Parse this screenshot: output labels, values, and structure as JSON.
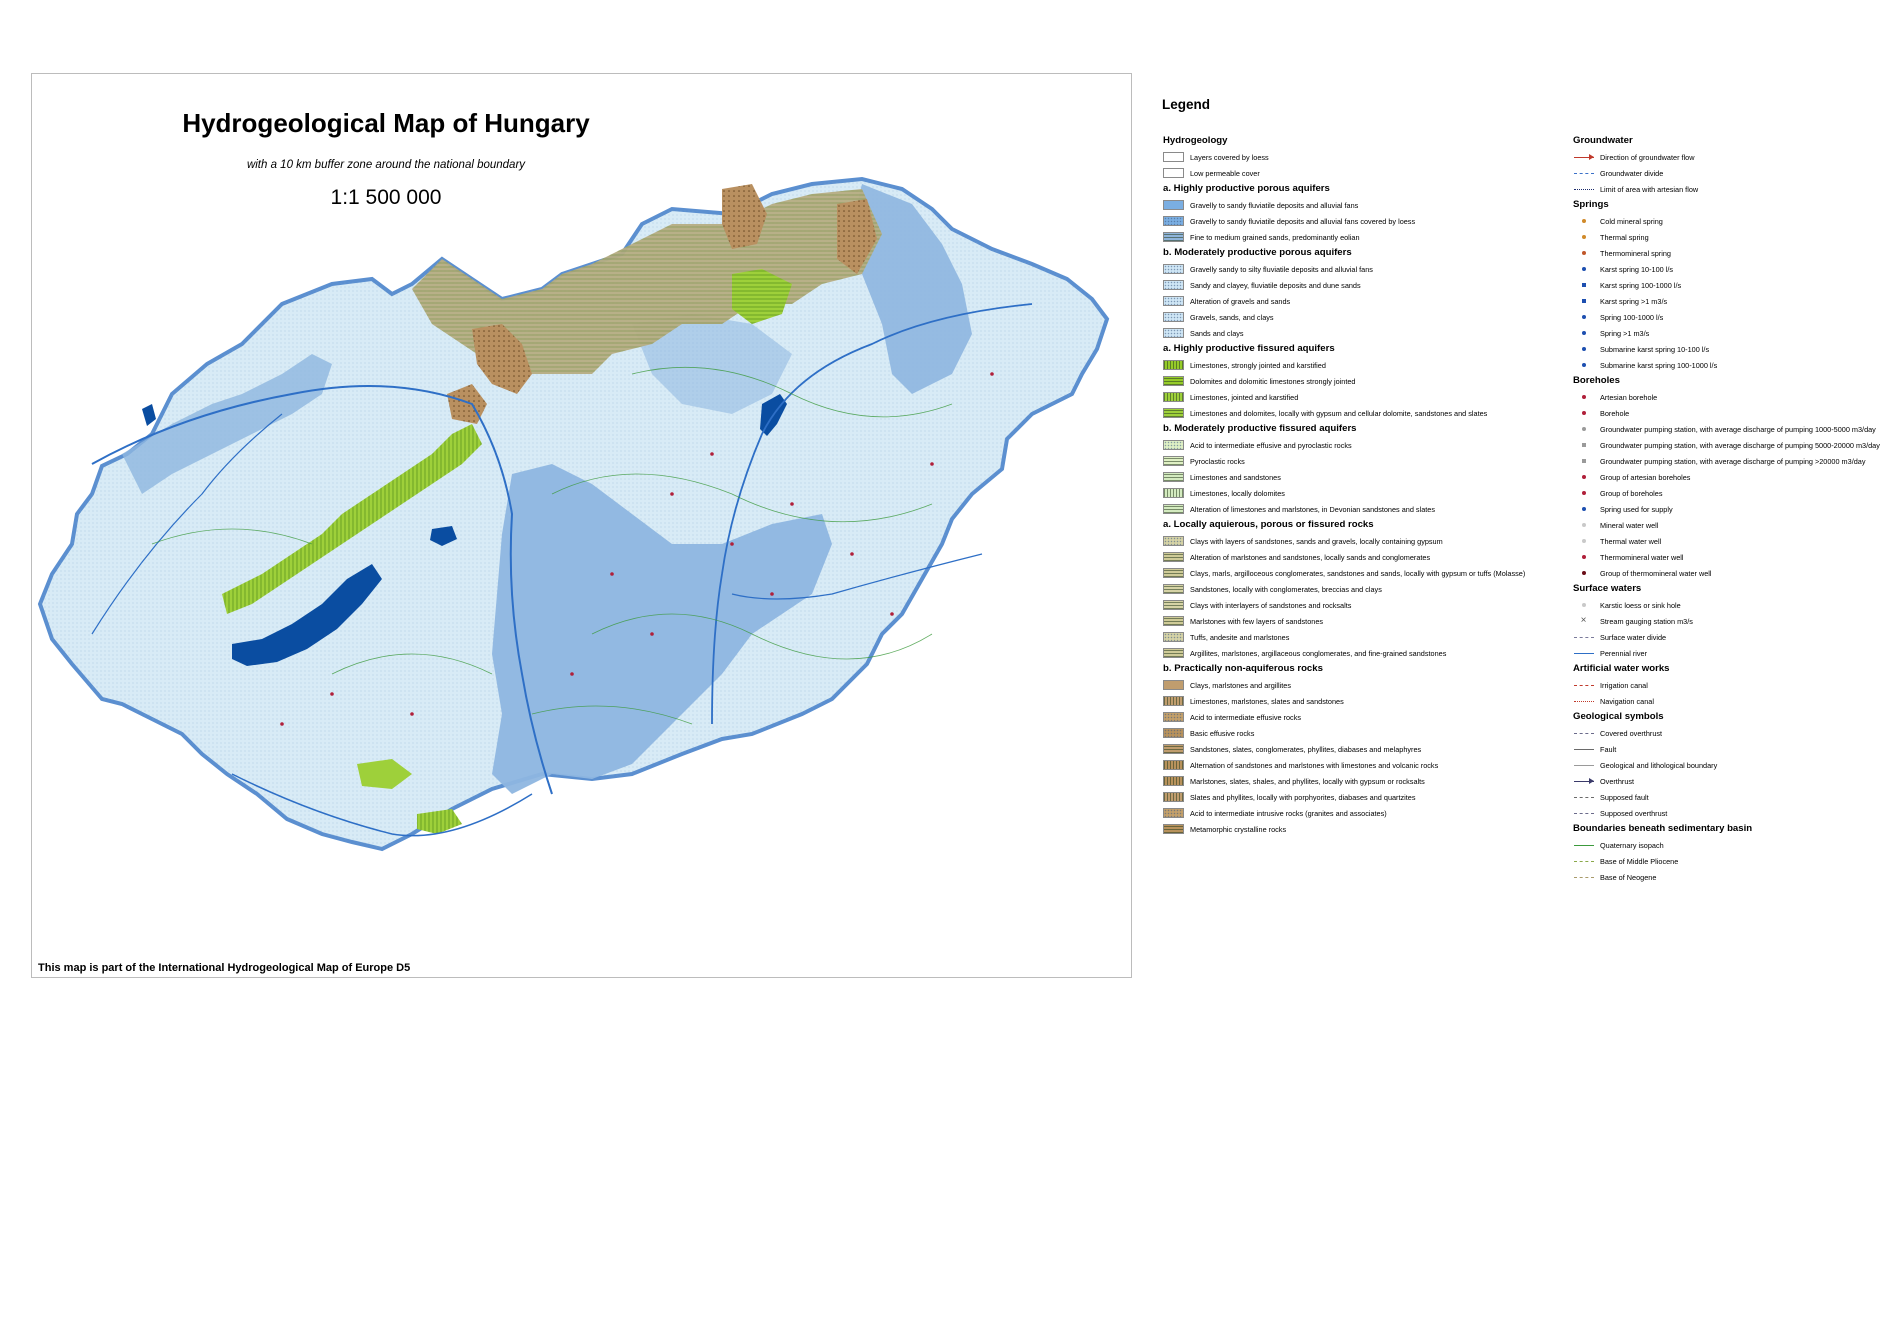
{
  "map": {
    "title": "Hydrogeological Map of Hungary",
    "subtitle": "with a 10 km buffer zone around the national boundary",
    "scale": "1:1 500 000",
    "footer": "This map is part of the International Hydrogeological Map of Europe D5",
    "colors": {
      "light_blue": "#d8ebf6",
      "mid_blue": "#8eb6e0",
      "deep_blue": "#6b9fd6",
      "lake": "#0a4da1",
      "lime": "#9ed03a",
      "olive": "#b6ad82",
      "brown": "#b99060",
      "river": "#2e6fc6",
      "contour": "#3c9a3c"
    }
  },
  "legend": {
    "title": "Legend",
    "col_a": [
      {
        "kind": "section",
        "text": "Hydrogeology"
      },
      {
        "kind": "item",
        "text": "Layers covered by loess",
        "swatch": "#ffffff",
        "pattern": "none"
      },
      {
        "kind": "item",
        "text": "Low permeable cover",
        "swatch": "#ffffff",
        "pattern": "none"
      },
      {
        "kind": "section",
        "text": "a. Highly productive porous aquifers"
      },
      {
        "kind": "item",
        "text": "Gravelly to sandy fluviatile deposits and alluvial fans",
        "swatch": "#7aaee2",
        "pattern": "none"
      },
      {
        "kind": "item",
        "text": "Gravelly to sandy fluviatile deposits and alluvial fans covered by loess",
        "swatch": "#7aaee2",
        "pattern": "dots"
      },
      {
        "kind": "item",
        "text": "Fine to medium grained sands, predominantly eolian",
        "swatch": "#8fb4da",
        "pattern": "lines"
      },
      {
        "kind": "section",
        "text": "b. Moderately productive porous aquifers"
      },
      {
        "kind": "item",
        "text": "Gravelly sandy to silty fluviatile deposits and alluvial fans",
        "swatch": "#cfe6f5",
        "pattern": "dots"
      },
      {
        "kind": "item",
        "text": "Sandy and clayey, fluviatile deposits and dune sands",
        "swatch": "#cfe6f5",
        "pattern": "dots"
      },
      {
        "kind": "item",
        "text": "Alteration of gravels and sands",
        "swatch": "#cfe6f5",
        "pattern": "dots"
      },
      {
        "kind": "item",
        "text": "Gravels, sands, and clays",
        "swatch": "#cfe6f5",
        "pattern": "dots"
      },
      {
        "kind": "item",
        "text": "Sands and clays",
        "swatch": "#cfe6f5",
        "pattern": "dots"
      },
      {
        "kind": "section",
        "text": "a. Highly productive fissured aquifers"
      },
      {
        "kind": "item",
        "text": "Limestones, strongly jointed and karstified",
        "swatch": "#96cc2a",
        "pattern": "vlines"
      },
      {
        "kind": "item",
        "text": "Dolomites and dolomitic limestones strongly jointed",
        "swatch": "#96cc2a",
        "pattern": "lines"
      },
      {
        "kind": "item",
        "text": "Limestones, jointed and karstified",
        "swatch": "#9ed03a",
        "pattern": "vlines"
      },
      {
        "kind": "item",
        "text": "Limestones and dolomites, locally with gypsum and cellular dolomite, sandstones and slates",
        "swatch": "#9ed03a",
        "pattern": "lines"
      },
      {
        "kind": "section",
        "text": "b. Moderately productive fissured aquifers"
      },
      {
        "kind": "item",
        "text": "Acid to intermediate effusive and pyroclastic rocks",
        "swatch": "#dff0c4",
        "pattern": "dots"
      },
      {
        "kind": "item",
        "text": "Pyroclastic rocks",
        "swatch": "#dff0c4",
        "pattern": "lines"
      },
      {
        "kind": "item",
        "text": "Limestones and sandstones",
        "swatch": "#d4ebc0",
        "pattern": "lines"
      },
      {
        "kind": "item",
        "text": "Limestones, locally dolomites",
        "swatch": "#d4ebc0",
        "pattern": "vlines"
      },
      {
        "kind": "item",
        "text": "Alteration of limestones and marlstones, in Devonian sandstones and slates",
        "swatch": "#d4ebc0",
        "pattern": "lines"
      },
      {
        "kind": "section",
        "text": "a. Locally aquierous, porous or fissured rocks"
      },
      {
        "kind": "item",
        "text": "Clays with layers of sandstones, sands and gravels, locally containing gypsum",
        "swatch": "#d6d3a6",
        "pattern": "dots"
      },
      {
        "kind": "item",
        "text": "Alteration of marlstones and sandstones, locally sands and conglomerates",
        "swatch": "#cfcb98",
        "pattern": "lines"
      },
      {
        "kind": "item",
        "text": "Clays, marls, argilloceous conglomerates, sandstones and sands, locally with gypsum or tuffs (Molasse)",
        "swatch": "#cfcb98",
        "pattern": "lines"
      },
      {
        "kind": "item",
        "text": "Sandstones, locally with conglomerates, breccias and clays",
        "swatch": "#d6d3a6",
        "pattern": "lines"
      },
      {
        "kind": "item",
        "text": "Clays with interlayers of sandstones and rocksalts",
        "swatch": "#d6d3a6",
        "pattern": "lines"
      },
      {
        "kind": "item",
        "text": "Marlstones with few layers of sandstones",
        "swatch": "#cfcb98",
        "pattern": "lines"
      },
      {
        "kind": "item",
        "text": "Tuffs, andesite and marlstones",
        "swatch": "#d6d3a6",
        "pattern": "dots"
      },
      {
        "kind": "item",
        "text": "Argillites, marlstones, argillaceous conglomerates, and fine-grained sandstones",
        "swatch": "#cfcb98",
        "pattern": "lines"
      },
      {
        "kind": "section",
        "text": "b. Practically non-aquiferous rocks"
      },
      {
        "kind": "item",
        "text": "Clays, marlstones and argillites",
        "swatch": "#c09d6e",
        "pattern": "none"
      },
      {
        "kind": "item",
        "text": "Limestones, marlstones, slates and sandstones",
        "swatch": "#c09d6e",
        "pattern": "vlines"
      },
      {
        "kind": "item",
        "text": "Acid to intermediate effusive rocks",
        "swatch": "#c4a06a",
        "pattern": "dots"
      },
      {
        "kind": "item",
        "text": "Basic effusive rocks",
        "swatch": "#b8925c",
        "pattern": "dots"
      },
      {
        "kind": "item",
        "text": "Sandstones, slates, conglomerates, phyllites, diabases and melaphyres",
        "swatch": "#c09d6e",
        "pattern": "lines"
      },
      {
        "kind": "item",
        "text": "Alternation of sandstones and marlstones with limestones and volcanic rocks",
        "swatch": "#b8925c",
        "pattern": "vlines"
      },
      {
        "kind": "item",
        "text": "Marlstones, slates, shales, and phyllites, locally with gypsum or rocksalts",
        "swatch": "#b8925c",
        "pattern": "vlines"
      },
      {
        "kind": "item",
        "text": "Slates and phyllites, locally with porphyorites, diabases and quartzites",
        "swatch": "#c09d6e",
        "pattern": "vlines"
      },
      {
        "kind": "item",
        "text": "Acid to intermediate intrusive rocks (granites and associates)",
        "swatch": "#c4a06a",
        "pattern": "dots"
      },
      {
        "kind": "item",
        "text": "Metamorphic crystalline rocks",
        "swatch": "#b8925c",
        "pattern": "lines"
      }
    ],
    "col_b": [
      {
        "kind": "section",
        "text": "Groundwater"
      },
      {
        "kind": "line",
        "text": "Direction of groundwater flow",
        "color": "#c0392b",
        "style": "arrow"
      },
      {
        "kind": "line",
        "text": "Groundwater divide",
        "color": "#3a70c8",
        "style": "dash"
      },
      {
        "kind": "line",
        "text": "Limit of area with artesian flow",
        "color": "#1a2a6a",
        "style": "dot2"
      },
      {
        "kind": "section",
        "text": "Springs"
      },
      {
        "kind": "marker",
        "text": "Cold mineral spring",
        "color": "#d08a2a",
        "shape": "dot"
      },
      {
        "kind": "marker",
        "text": "Thermal spring",
        "color": "#d08a2a",
        "shape": "dot"
      },
      {
        "kind": "marker",
        "text": "Thermomineral spring",
        "color": "#c0562a",
        "shape": "dot"
      },
      {
        "kind": "marker",
        "text": "Karst spring 10-100 l/s",
        "color": "#1d4fb0",
        "shape": "dot"
      },
      {
        "kind": "marker",
        "text": "Karst spring 100-1000 l/s",
        "color": "#1d4fb0",
        "shape": "square"
      },
      {
        "kind": "marker",
        "text": "Karst spring >1 m3/s",
        "color": "#1d4fb0",
        "shape": "square"
      },
      {
        "kind": "marker",
        "text": "Spring 100-1000 l/s",
        "color": "#1d4fb0",
        "shape": "dot"
      },
      {
        "kind": "marker",
        "text": "Spring >1 m3/s",
        "color": "#1d4fb0",
        "shape": "dot"
      },
      {
        "kind": "marker",
        "text": "Submarine karst spring 10-100 l/s",
        "color": "#1d4fb0",
        "shape": "dot"
      },
      {
        "kind": "marker",
        "text": "Submarine karst spring 100-1000 l/s",
        "color": "#1d4fb0",
        "shape": "dot"
      },
      {
        "kind": "section",
        "text": "Boreholes"
      },
      {
        "kind": "marker",
        "text": "Artesian borehole",
        "color": "#b0203a",
        "shape": "dot"
      },
      {
        "kind": "marker",
        "text": "Borehole",
        "color": "#b0203a",
        "shape": "dot"
      },
      {
        "kind": "marker",
        "text": "Groundwater pumping station, with average discharge of pumping 1000-5000 m3/day",
        "color": "#9a9a9a",
        "shape": "dot"
      },
      {
        "kind": "marker",
        "text": "Groundwater pumping station, with average discharge of pumping 5000-20000 m3/day",
        "color": "#9a9a9a",
        "shape": "square"
      },
      {
        "kind": "marker",
        "text": "Groundwater pumping station, with average discharge of pumping >20000 m3/day",
        "color": "#9a9a9a",
        "shape": "square"
      },
      {
        "kind": "marker",
        "text": "Group of artesian boreholes",
        "color": "#b0203a",
        "shape": "dot"
      },
      {
        "kind": "marker",
        "text": "Group of boreholes",
        "color": "#b0203a",
        "shape": "dot"
      },
      {
        "kind": "marker",
        "text": "Spring used for supply",
        "color": "#1d4fb0",
        "shape": "dot"
      },
      {
        "kind": "marker",
        "text": "Mineral water well",
        "color": "#c9c9c9",
        "shape": "dot"
      },
      {
        "kind": "marker",
        "text": "Thermal water well",
        "color": "#c9c9c9",
        "shape": "dot"
      },
      {
        "kind": "marker",
        "text": "Thermomineral water well",
        "color": "#b0203a",
        "shape": "dot"
      },
      {
        "kind": "marker",
        "text": "Group of thermomineral water well",
        "color": "#6a0d18",
        "shape": "dot"
      },
      {
        "kind": "section",
        "text": "Surface waters"
      },
      {
        "kind": "marker",
        "text": "Karstic loess or sink hole",
        "color": "#c9c9c9",
        "shape": "dot"
      },
      {
        "kind": "marker",
        "text": "Stream gauging station m3/s",
        "color": "#555555",
        "shape": "x"
      },
      {
        "kind": "line",
        "text": "Surface water divide",
        "color": "#7a7a9a",
        "style": "dash"
      },
      {
        "kind": "line",
        "text": "Perennial river",
        "color": "#2e6fc6",
        "style": "solid"
      },
      {
        "kind": "section",
        "text": "Artificial water works"
      },
      {
        "kind": "line",
        "text": "Irrigation canal",
        "color": "#c0392b",
        "style": "dash"
      },
      {
        "kind": "line",
        "text": "Navigation canal",
        "color": "#c0392b",
        "style": "dot2"
      },
      {
        "kind": "section",
        "text": "Geological symbols"
      },
      {
        "kind": "line",
        "text": "Covered overthrust",
        "color": "#6a6a8a",
        "style": "dash"
      },
      {
        "kind": "line",
        "text": "Fault",
        "color": "#6a6a6a",
        "style": "solid"
      },
      {
        "kind": "line",
        "text": "Geological and lithological boundary",
        "color": "#9a9a9a",
        "style": "solid"
      },
      {
        "kind": "line",
        "text": "Overthrust",
        "color": "#3a3a6a",
        "style": "arrow"
      },
      {
        "kind": "line",
        "text": "Supposed fault",
        "color": "#6a6a6a",
        "style": "dash"
      },
      {
        "kind": "line",
        "text": "Supposed overthrust",
        "color": "#6a6a8a",
        "style": "dash"
      },
      {
        "kind": "section",
        "text": "Boundaries beneath sedimentary basin"
      },
      {
        "kind": "line",
        "text": "Quaternary isopach",
        "color": "#3c9a3c",
        "style": "solid"
      },
      {
        "kind": "line",
        "text": "Base of Middle Pliocene",
        "color": "#8aa84a",
        "style": "dash"
      },
      {
        "kind": "line",
        "text": "Base of Neogene",
        "color": "#a89a6a",
        "style": "dash"
      }
    ]
  }
}
